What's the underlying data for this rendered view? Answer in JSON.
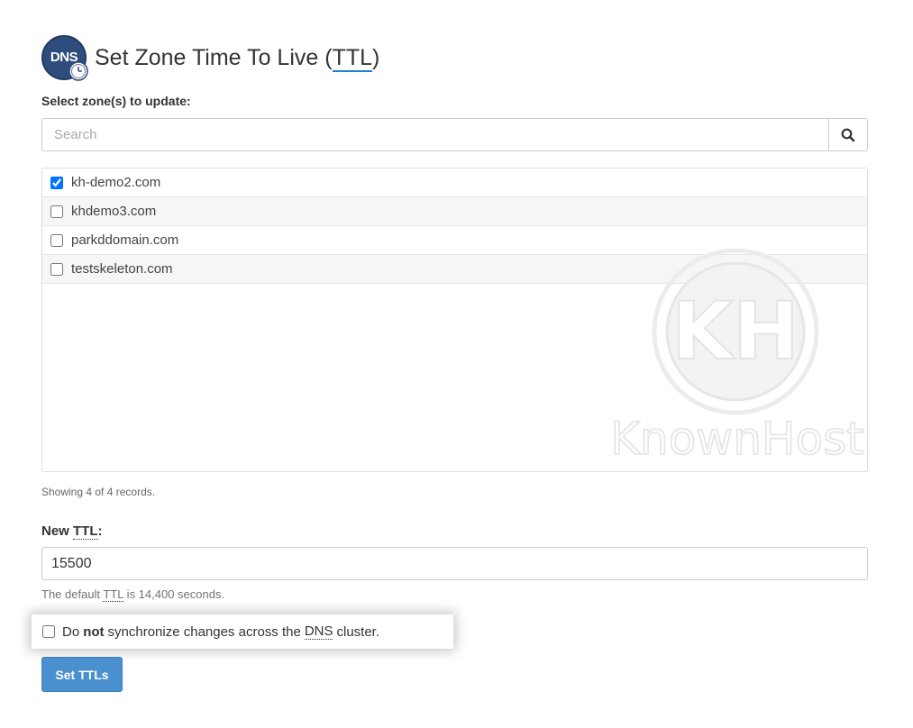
{
  "header": {
    "icon_text": "DNS",
    "title_prefix": "Set Zone Time To Live (",
    "title_abbr": "TTL",
    "title_suffix": ")"
  },
  "zone_select": {
    "label": "Select zone(s) to update:",
    "search_placeholder": "Search",
    "zones": [
      {
        "name": "kh-demo2.com",
        "checked": true
      },
      {
        "name": "khdemo3.com",
        "checked": false
      },
      {
        "name": "parkddomain.com",
        "checked": false
      },
      {
        "name": "testskeleton.com",
        "checked": false
      }
    ],
    "records_text": "Showing 4 of 4 records."
  },
  "ttl": {
    "label_prefix": "New ",
    "label_abbr": "TTL",
    "label_suffix": ":",
    "value": "15500",
    "help_prefix": "The default ",
    "help_abbr": "TTL",
    "help_suffix": " is 14,400 seconds."
  },
  "sync": {
    "text_1": "Do",
    "text_bold": "not",
    "text_2": "synchronize changes across the",
    "text_abbr": "DNS",
    "text_3": "cluster.",
    "checked": false
  },
  "submit": {
    "label": "Set TTLs"
  },
  "watermark": {
    "text": "KnownHost"
  },
  "colors": {
    "primary_button": "#4a90cf",
    "icon_bg": "#2f4d7c",
    "title_underline": "#1e7fd0"
  }
}
